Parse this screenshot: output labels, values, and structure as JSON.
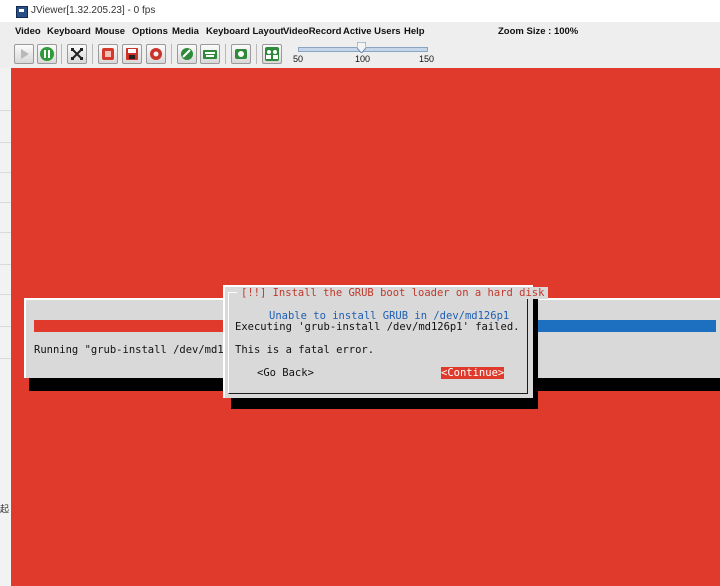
{
  "window": {
    "title": "JViewer[1.32.205.23] - 0 fps"
  },
  "menubar": {
    "items": [
      "Video",
      "Keyboard",
      "Mouse",
      "Options",
      "Media",
      "Keyboard Layout",
      "VideoRecord",
      "Active Users",
      "Help"
    ],
    "zoom_size": "Zoom Size : 100%"
  },
  "toolbar": {
    "buttons": [
      "play-icon",
      "pause-icon",
      "fullscreen-icon",
      "record-stop-icon",
      "save-icon",
      "hard-drive-icon",
      "mouse-icon",
      "keyboard-icon",
      "screenshot-icon",
      "users-icon"
    ],
    "zoom_slider": {
      "min_label": "50",
      "mid_label": "100",
      "max_label": "150",
      "value": 100
    }
  },
  "left_strip": {
    "glyph": "起"
  },
  "colors": {
    "screen_red": "#e03a2c",
    "progress_blue": "#1d6fbf",
    "dialog_gray": "#d9d9d9",
    "heading_blue": "#1f5fb3"
  },
  "progress": {
    "running_text": "Running \"grub-install /dev/md126p",
    "fraction": 0.29
  },
  "dialog": {
    "title": "[!!] Install the GRUB boot loader on a hard disk",
    "heading": "Unable to install GRUB in /dev/md126p1",
    "line1": "Executing 'grub-install /dev/md126p1' failed.",
    "line2": "This is a fatal error.",
    "back_button": "<Go Back>",
    "continue_button": "<Continue>"
  }
}
